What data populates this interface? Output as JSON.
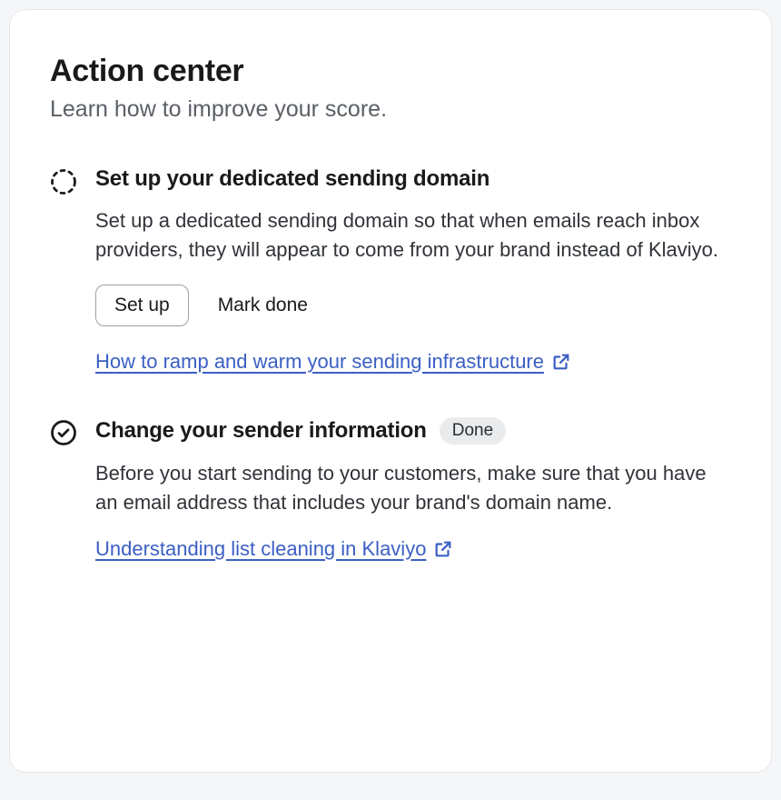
{
  "header": {
    "title": "Action center",
    "subtitle": "Learn how to improve your score."
  },
  "items": [
    {
      "status": "pending",
      "title": "Set up your dedicated sending domain",
      "description": "Set up a dedicated sending domain so that when emails reach inbox providers, they will appear to come from your brand instead of Klaviyo.",
      "primary_button": "Set up",
      "secondary_button": "Mark done",
      "help_link": "How to ramp and warm your sending infrastructure"
    },
    {
      "status": "done",
      "badge": "Done",
      "title": "Change your sender information",
      "description": "Before you start sending to your customers, make sure that you have an email address that includes your brand's domain name.",
      "help_link": "Understanding list cleaning in Klaviyo"
    }
  ]
}
